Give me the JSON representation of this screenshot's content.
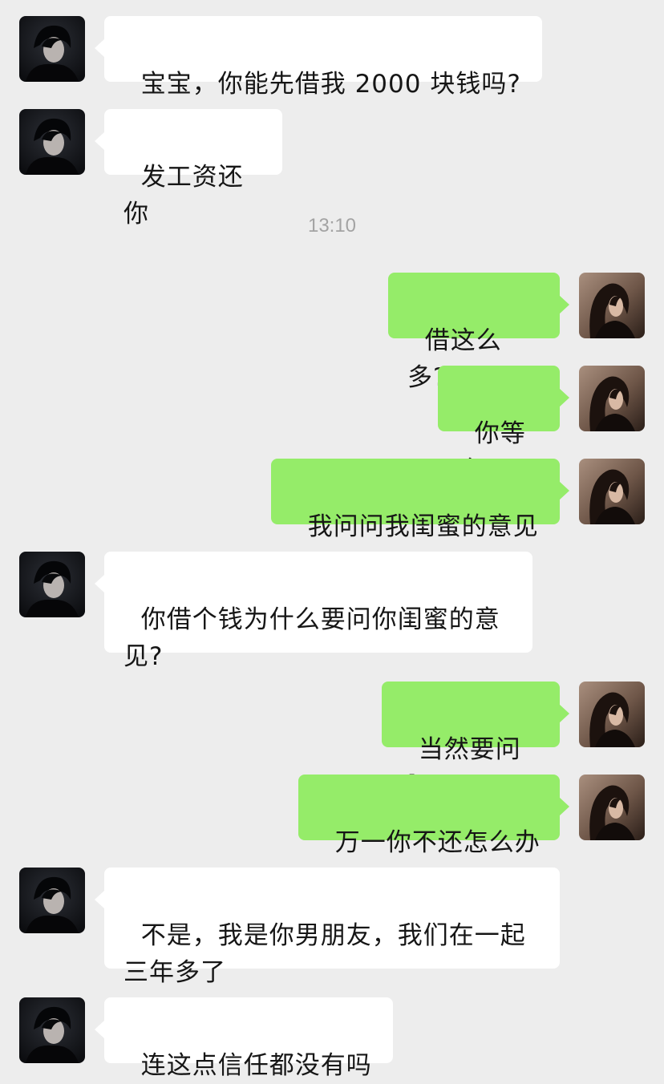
{
  "chat": {
    "timestamp": "13:10",
    "messages": [
      {
        "sender": "boyfriend",
        "text": "宝宝，你能先借我 2000 块钱吗?"
      },
      {
        "sender": "boyfriend",
        "text": "发工资还你"
      },
      {
        "sender": "me",
        "text": "借这么多?"
      },
      {
        "sender": "me",
        "text": "你等会"
      },
      {
        "sender": "me",
        "text": "我问问我闺蜜的意见"
      },
      {
        "sender": "boyfriend",
        "text": "你借个钱为什么要问你闺蜜的意见?"
      },
      {
        "sender": "me",
        "text": "当然要问啊"
      },
      {
        "sender": "me",
        "text": "万一你不还怎么办"
      },
      {
        "sender": "boyfriend",
        "text": "不是，我是你男朋友，我们在一起三年多了"
      },
      {
        "sender": "boyfriend",
        "text": "连这点信任都没有吗"
      }
    ]
  }
}
